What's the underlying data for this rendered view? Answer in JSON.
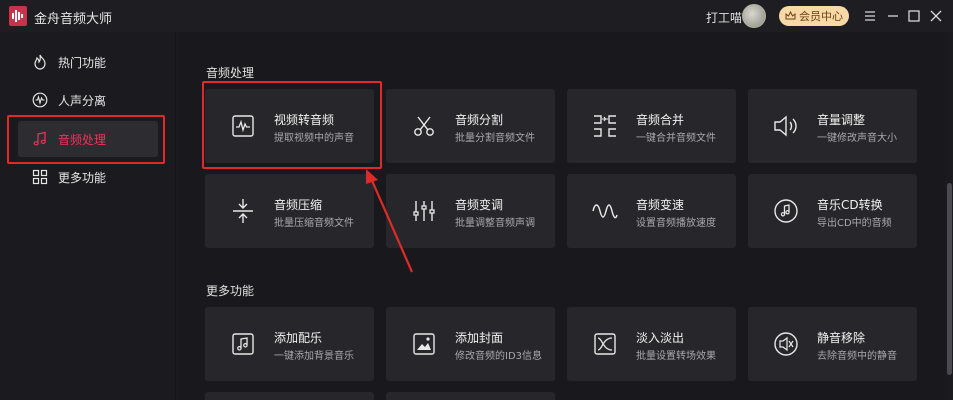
{
  "app": {
    "title": "金舟音频大师"
  },
  "header": {
    "user_name": "打工喵",
    "vip_label": "会员中心",
    "accent": "#f6d9a6"
  },
  "sidebar": {
    "items": [
      {
        "label": "热门功能",
        "icon": "flame-icon",
        "active": false
      },
      {
        "label": "人声分离",
        "icon": "waveform-circle-icon",
        "active": false
      },
      {
        "label": "音频处理",
        "icon": "music-note-icon",
        "active": true
      },
      {
        "label": "更多功能",
        "icon": "grid-icon",
        "active": false
      }
    ],
    "active_color": "#f0335a"
  },
  "sections": [
    {
      "title": "音频处理",
      "cards": [
        {
          "title": "视频转音频",
          "desc": "提取视频中的声音",
          "icon": "video-to-audio-icon"
        },
        {
          "title": "音频分割",
          "desc": "批量分割音频文件",
          "icon": "scissors-icon"
        },
        {
          "title": "音频合并",
          "desc": "一键合并音频文件",
          "icon": "merge-icon"
        },
        {
          "title": "音量调整",
          "desc": "一键修改声音大小",
          "icon": "speaker-icon"
        },
        {
          "title": "音频压缩",
          "desc": "批量压缩音频文件",
          "icon": "compress-icon"
        },
        {
          "title": "音频变调",
          "desc": "批量调整音频声调",
          "icon": "equalizer-icon"
        },
        {
          "title": "音频变速",
          "desc": "设置音频播放速度",
          "icon": "wave-icon"
        },
        {
          "title": "音乐CD转换",
          "desc": "导出CD中的音频",
          "icon": "cd-icon"
        }
      ]
    },
    {
      "title": "更多功能",
      "cards": [
        {
          "title": "添加配乐",
          "desc": "一键添加背景音乐",
          "icon": "music-box-icon"
        },
        {
          "title": "添加封面",
          "desc": "修改音频的ID3信息",
          "icon": "image-icon"
        },
        {
          "title": "淡入淡出",
          "desc": "批量设置转场效果",
          "icon": "fade-icon"
        },
        {
          "title": "静音移除",
          "desc": "去除音频中的静音",
          "icon": "mute-icon"
        }
      ]
    }
  ],
  "annotation_color": "#e02a2a"
}
